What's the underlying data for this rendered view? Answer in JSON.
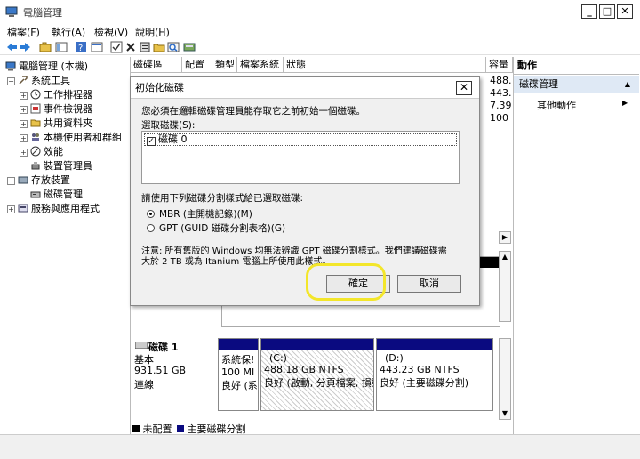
{
  "window": {
    "title": "電腦管理"
  },
  "menu": [
    "檔案(F)",
    "執行(A)",
    "檢視(V)",
    "說明(H)"
  ],
  "tree": {
    "root": "電腦管理 (本機)",
    "system_tools": "系統工具",
    "task_scheduler": "工作排程器",
    "event_viewer": "事件檢視器",
    "shared_folders": "共用資料夾",
    "local_users": "本機使用者和群組",
    "performance": "效能",
    "device_manager": "裝置管理員",
    "storage": "存放裝置",
    "disk_management": "磁碟管理",
    "services_apps": "服務與應用程式"
  },
  "columns": [
    "磁碟區",
    "配置",
    "類型",
    "檔案系統",
    "狀態",
    "容量"
  ],
  "capacity_values": [
    "488.",
    "443.",
    "7.39",
    "100"
  ],
  "actions": {
    "header": "動作",
    "selected": "磁碟管理",
    "more": "其他動作"
  },
  "disk1": {
    "name": "磁碟 1",
    "type": "基本",
    "size": "931.51 GB",
    "status": "連線",
    "partitions": [
      {
        "line1": "系統保!",
        "line2": "100 MI",
        "line3": "良好 (系"
      },
      {
        "line1": "(C:)",
        "line2": "488.18 GB NTFS",
        "line3": "良好 (啟動, 分頁檔案, 損毀"
      },
      {
        "line1": "(D:)",
        "line2": "443.23 GB NTFS",
        "line3": "良好 (主要磁碟分割)"
      }
    ]
  },
  "legend": {
    "unallocated": "未配置",
    "primary": "主要磁碟分割"
  },
  "dialog": {
    "title": "初始化磁碟",
    "intro": "您必須在邏輯磁碟管理員能存取它之前初始一個磁碟。",
    "select_label": "選取磁碟(S):",
    "disk_item": "磁碟 0",
    "style_label": "請使用下列磁碟分割樣式給已選取磁碟:",
    "mbr": "MBR (主開機記錄)(M)",
    "gpt": "GPT (GUID 磁碟分割表格)(G)",
    "note1": "注意: 所有舊版的 Windows 均無法辨識 GPT 磁碟分割樣式。我們建議磁碟需",
    "note2": "大於 2 TB 或為 Itanium 電腦上所使用此樣式。",
    "ok": "確定",
    "cancel": "取消"
  },
  "colors": {
    "partition_bar": "#0a0a80",
    "highlight": "#f3e62a",
    "selected_bg": "#dfe9f5"
  }
}
